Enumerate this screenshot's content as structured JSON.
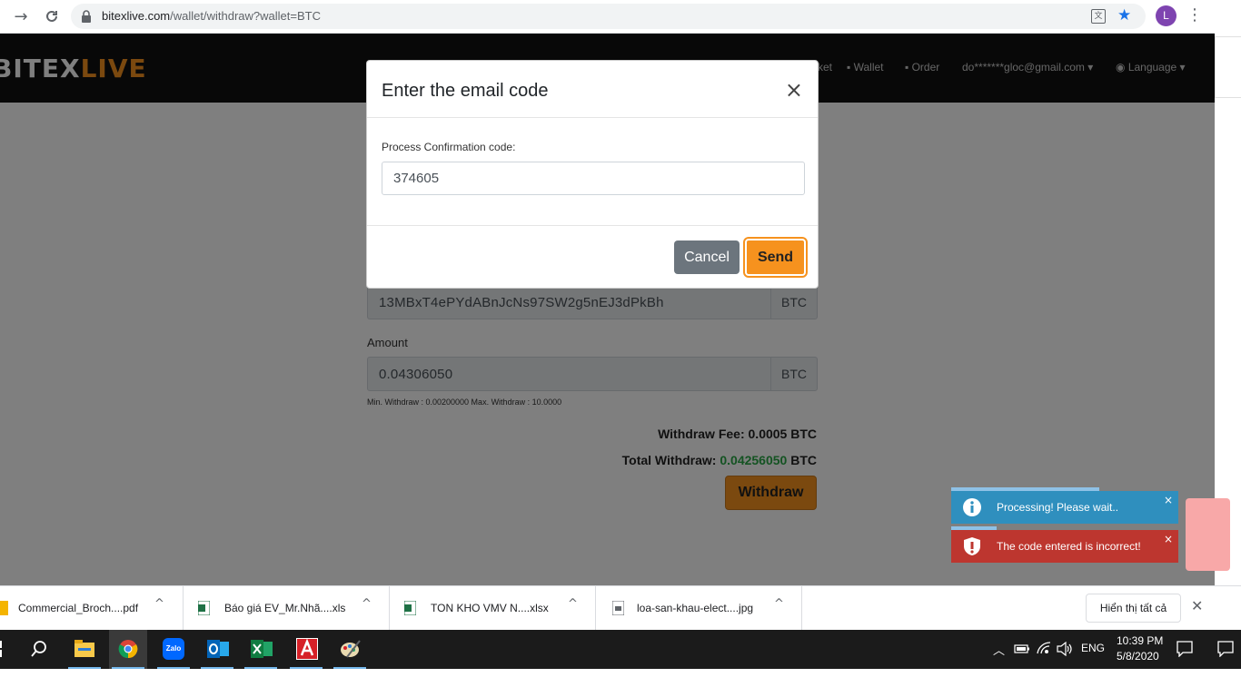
{
  "browser": {
    "url_host": "bitexlive.com",
    "url_path": "/wallet/withdraw?wallet=BTC",
    "translate_glyph": "文",
    "profile_initial": "L"
  },
  "site": {
    "logo_white": "BITEX",
    "logo_orange": "LIVE",
    "nav": {
      "market_partial": "ket",
      "wallet": "Wallet",
      "order": "Order",
      "email": "do*******gloc@gmail.com",
      "language": "Language"
    },
    "form": {
      "address_value": "13MBxT4ePYdABnJcNs97SW2g5nEJ3dPkBh",
      "address_suffix": "BTC",
      "amount_label": "Amount",
      "amount_value": "0.04306050",
      "amount_suffix": "BTC",
      "limits": "Min. Withdraw : 0.00200000 Max. Withdraw : 10.0000",
      "fee_label": "Withdraw Fee:",
      "fee_value": "0.0005 BTC",
      "total_label": "Total Withdraw:",
      "total_value": "0.04256050",
      "total_unit": "BTC",
      "withdraw_button": "Withdraw"
    }
  },
  "modal": {
    "title": "Enter the email code",
    "field_label": "Process Confirmation code:",
    "field_value": "374605",
    "cancel": "Cancel",
    "send": "Send"
  },
  "toasts": [
    {
      "message": "Processing! Please wait..",
      "color": "#2f8fbe",
      "icon": "info-icon",
      "progress": 0.65
    },
    {
      "message": "The code entered is incorrect!",
      "color": "#bd362f",
      "icon": "exclamation-shield-icon",
      "progress": 0.2
    }
  ],
  "downloads": {
    "items": [
      {
        "name": "Commercial_Broch....pdf",
        "icon": "pdf-file-icon"
      },
      {
        "name": "Báo giá EV_Mr.Nhã....xls",
        "icon": "excel-file-icon"
      },
      {
        "name": "TON KHO VMV N....xlsx",
        "icon": "excel-file-icon"
      },
      {
        "name": "loa-san-khau-elect....jpg",
        "icon": "image-file-icon"
      }
    ],
    "show_all": "Hiển thị tất cả"
  },
  "taskbar": {
    "language": "ENG",
    "time": "10:39 PM",
    "date": "5/8/2020",
    "zalo_label": "Zalo"
  },
  "colors": {
    "accent_orange": "#f6921e",
    "header_black": "#111111",
    "total_green": "#28a745"
  }
}
